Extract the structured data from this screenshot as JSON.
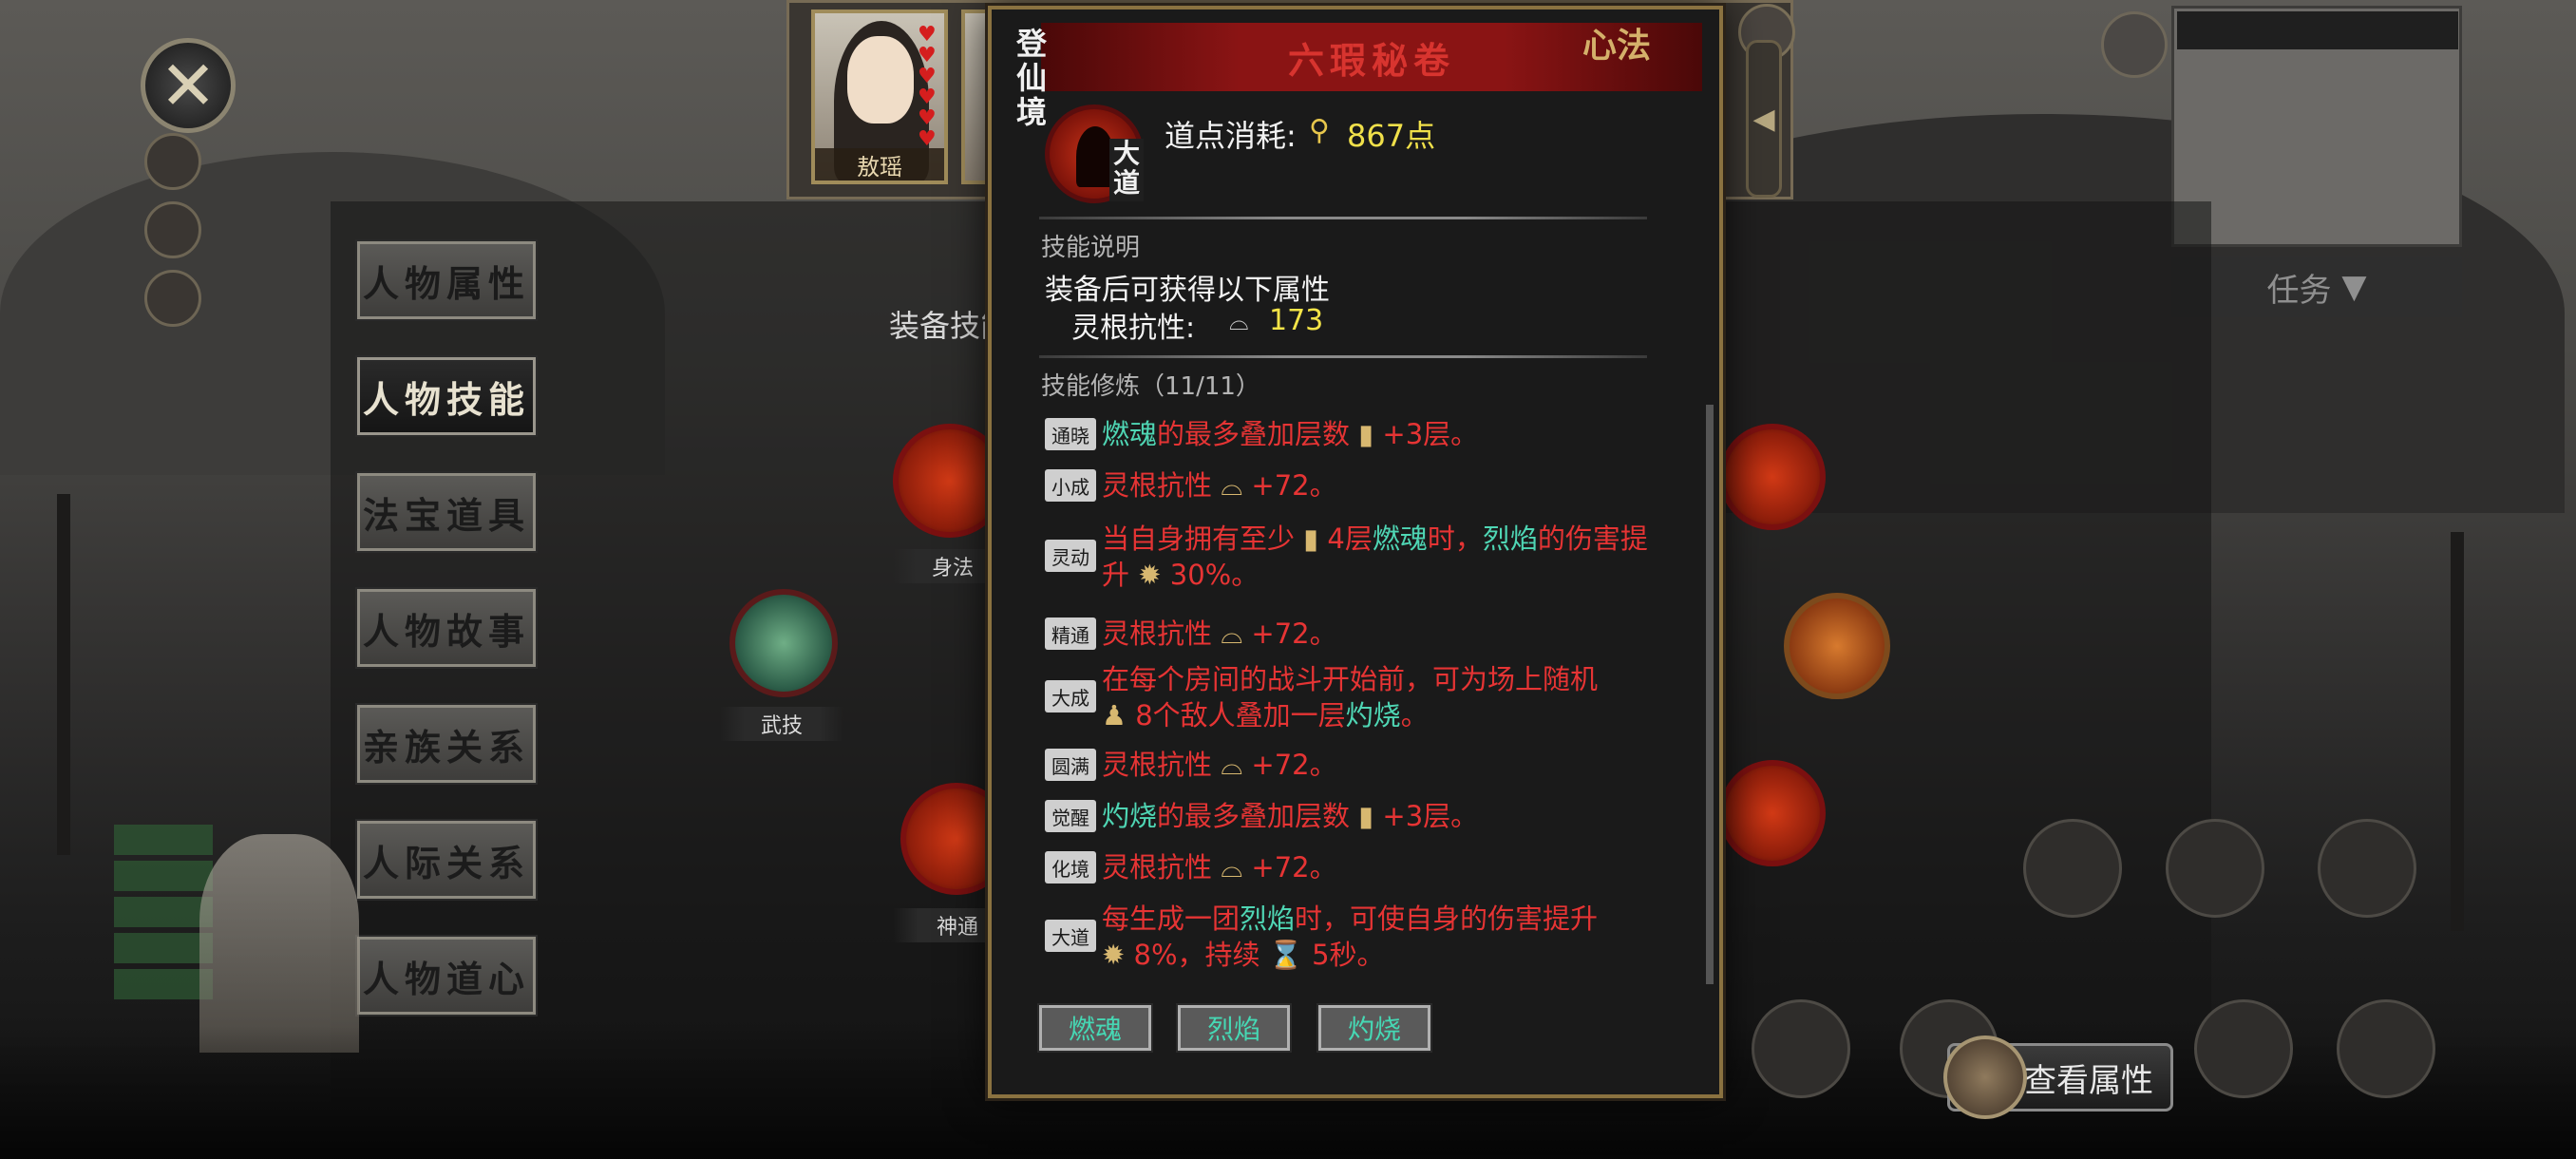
{
  "menu": {
    "items": [
      "人物属性",
      "人物技能",
      "法宝道具",
      "人物故事",
      "亲族关系",
      "人际关系",
      "人物道心"
    ],
    "active_index": 1
  },
  "skills_panel": {
    "equip_label": "装备技能",
    "nodes": [
      {
        "label": "身法"
      },
      {
        "label": "武技"
      },
      {
        "label": "神通"
      }
    ]
  },
  "party": {
    "portrait_name": "敖瑶",
    "realm_badge": "登仙"
  },
  "top_right": {
    "task_label": "任务"
  },
  "popup": {
    "title": "六瑕秘卷",
    "type_tag": "心法",
    "realm": "登仙境",
    "rank_badge": "大道",
    "cost_label": "道点消耗:",
    "cost_value": "867点",
    "desc_section": "技能说明",
    "desc_line": "装备后可获得以下属性",
    "stat_label": "灵根抗性:",
    "stat_value": "173",
    "train_section": "技能修炼（11/11）",
    "train_rows": [
      {
        "stage": "通晓",
        "line1": "燃魂的最多叠加层数 ▮ +3层。",
        "line2": ""
      },
      {
        "stage": "小成",
        "line1": "灵根抗性 ⌓ +72。",
        "line2": ""
      },
      {
        "stage": "灵动",
        "line1": "当自身拥有至少 ▮ 4层燃魂时，烈焰的伤害提",
        "line2": "升 ✹ 30%。"
      },
      {
        "stage": "精通",
        "line1": "灵根抗性 ⌓ +72。",
        "line2": ""
      },
      {
        "stage": "大成",
        "line1": "在每个房间的战斗开始前，可为场上随机",
        "line2": "♟ 8个敌人叠加一层灼烧。"
      },
      {
        "stage": "圆满",
        "line1": "灵根抗性 ⌓ +72。",
        "line2": ""
      },
      {
        "stage": "觉醒",
        "line1": "灼烧的最多叠加层数 ▮ +3层。",
        "line2": ""
      },
      {
        "stage": "化境",
        "line1": "灵根抗性 ⌓ +72。",
        "line2": ""
      },
      {
        "stage": "大道",
        "line1": "每生成一团烈焰时，可使自身的伤害提升",
        "line2": "✹ 8%，持续 ⌛ 5秒。"
      }
    ],
    "keywords": [
      "燃魂",
      "烈焰",
      "灼烧"
    ]
  },
  "bottom": {
    "view_attr_label": "查看属性"
  },
  "colors": {
    "accent_red": "#e63434",
    "keyword_cyan": "#4fd6b4",
    "value_yellow": "#f0e04a",
    "frame_gold": "#8a7240"
  }
}
